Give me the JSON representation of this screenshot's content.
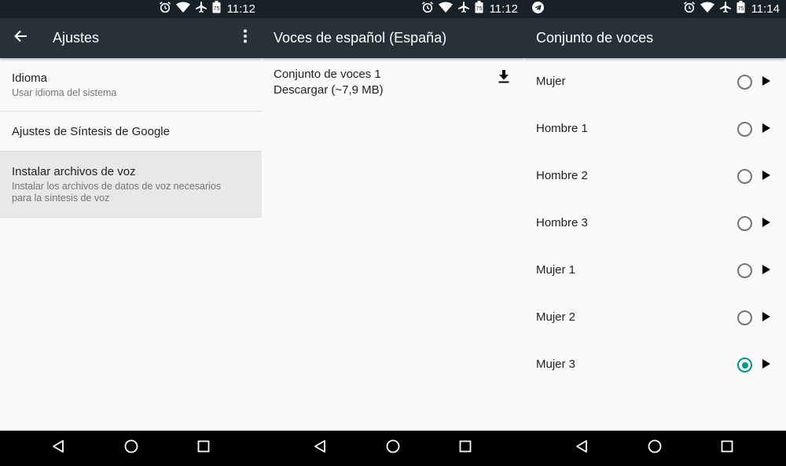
{
  "status_bars": [
    {
      "time": "11:12"
    },
    {
      "time": "11:12"
    },
    {
      "time": "11:14"
    }
  ],
  "screen1": {
    "title": "Ajustes",
    "items": [
      {
        "title": "Idioma",
        "summary": "Usar idioma del sistema"
      },
      {
        "title": "Ajustes de Síntesis de Google"
      },
      {
        "title": "Instalar archivos de voz",
        "summary_line1": "Instalar los archivos de datos de voz necesarios",
        "summary_line2": "para la síntesis de voz"
      }
    ]
  },
  "screen2": {
    "title": "Voces de español (España)",
    "item": {
      "title": "Conjunto de voces 1",
      "summary": "Descargar (~7,9 MB)"
    }
  },
  "screen3": {
    "title": "Conjunto de voces",
    "voices": [
      {
        "label": "Mujer",
        "selected": false
      },
      {
        "label": "Hombre 1",
        "selected": false
      },
      {
        "label": "Hombre 2",
        "selected": false
      },
      {
        "label": "Hombre 3",
        "selected": false
      },
      {
        "label": "Mujer 1",
        "selected": false
      },
      {
        "label": "Mujer 2",
        "selected": false
      },
      {
        "label": "Mujer 3",
        "selected": true
      }
    ]
  },
  "icons": {
    "status": [
      "alarm-icon",
      "wifi-icon",
      "airplane-mode-icon",
      "battery-icon"
    ],
    "telegram": "telegram-icon",
    "back": "arrow-back-icon",
    "overflow": "more-vert-icon",
    "download": "download-icon",
    "play": "play-icon",
    "nav": [
      "nav-back-icon",
      "nav-home-icon",
      "nav-recents-icon"
    ]
  },
  "colors": {
    "status_bar": "#172127",
    "app_bar": "#263238",
    "accent": "#009688",
    "background": "#fafafa"
  }
}
